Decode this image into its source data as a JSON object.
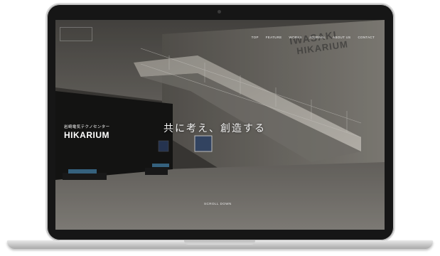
{
  "site": {
    "nav": [
      "TOP",
      "FEATURE",
      "WORKS",
      "JOURNAL",
      "ABOUT US",
      "CONTACT"
    ],
    "hero_tagline": "共に考え、創造する",
    "sign_jp": "岩崎電気テクノセンター",
    "sign_en": "HIKARIUM",
    "wall_en_1": "IWASAKI",
    "wall_en_2": "HIKARIUM",
    "scroll_label": "SCROLL DOWN"
  }
}
